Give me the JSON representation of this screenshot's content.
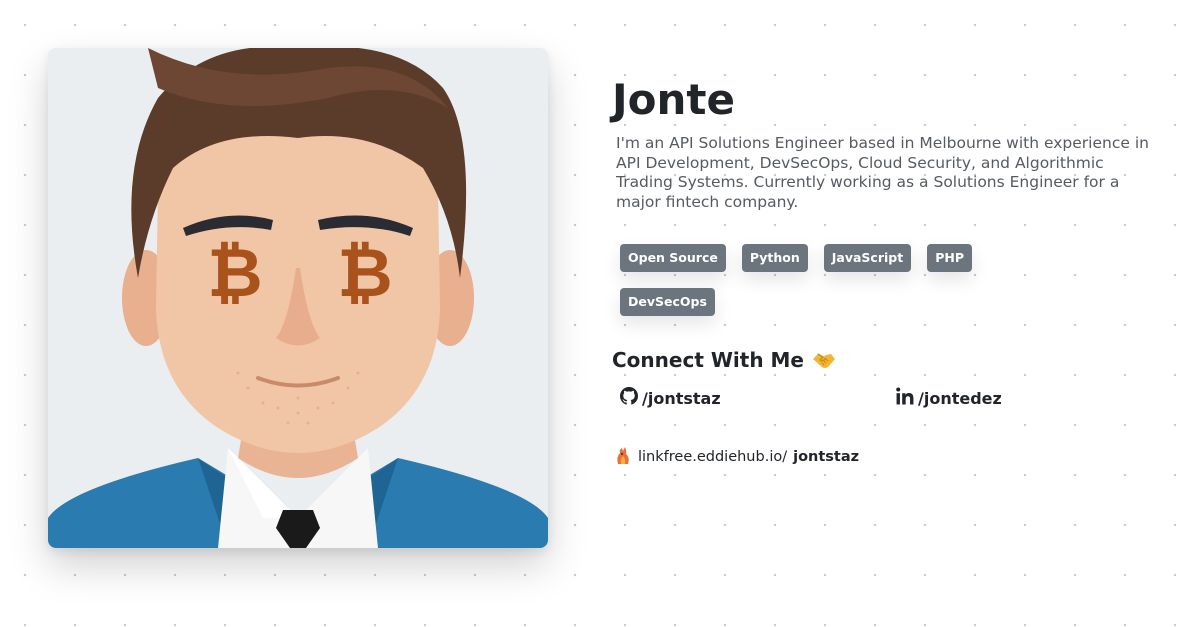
{
  "profile": {
    "name": "Jonte",
    "bio": "I'm an API Solutions Engineer based in Melbourne with experience in API Development, DevSecOps, Cloud Security, and Algorithmic Trading Systems. Currently working as a Solutions Engineer for a major fintech company.",
    "avatar_icon": "cartoon-avatar-bitcoin-eyes"
  },
  "tags": [
    {
      "label": "Open Source"
    },
    {
      "label": "Python"
    },
    {
      "label": "JavaScript"
    },
    {
      "label": "PHP"
    },
    {
      "label": "DevSecOps"
    }
  ],
  "connect": {
    "title": "Connect With Me",
    "emoji_icon": "handshake-icon",
    "github": {
      "icon": "github-icon",
      "label": "/jontstaz"
    },
    "linkedin": {
      "icon": "linkedin-icon",
      "label": "/jontedez"
    }
  },
  "linkfree": {
    "icon": "linkfree-logo-icon",
    "domain": "linkfree.eddiehub.io/",
    "handle": "jontstaz"
  },
  "colors": {
    "tag_bg": "#6c757d",
    "text_dark": "#212529",
    "text_muted": "#555b61",
    "suit_blue": "#2a7bb0",
    "hair_brown": "#5b3b29",
    "skin": "#f1c6a6",
    "bitcoin_orange": "#a9521c"
  }
}
